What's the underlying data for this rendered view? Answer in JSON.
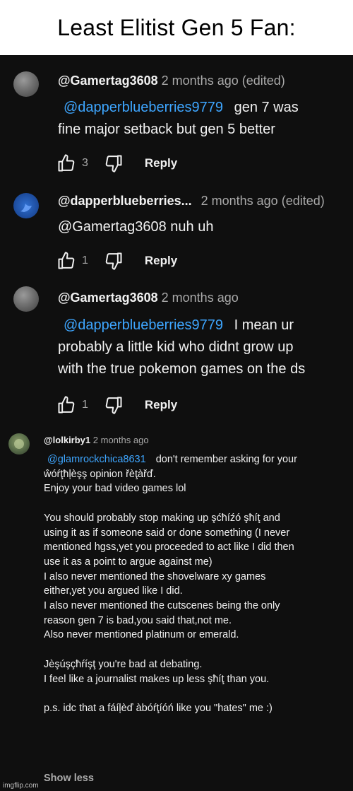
{
  "caption": "Least Elitist Gen 5 Fan:",
  "comments": [
    {
      "handle": "@Gamertag3608",
      "meta": "2 months ago (edited)",
      "mention": "@dapperblueberries9779",
      "lines": [
        "gen 7 was",
        "fine major setback but gen 5 better"
      ],
      "likes": "3",
      "reply": "Reply"
    },
    {
      "handle": "@dapperblueberries...",
      "meta": "2 months ago (edited)",
      "lines": [
        "@Gamertag3608 nuh uh"
      ],
      "likes": "1",
      "reply": "Reply"
    },
    {
      "handle": "@Gamertag3608",
      "meta": "2 months ago",
      "mention": "@dapperblueberries9779",
      "lines": [
        "I mean ur",
        "probably a little kid who didnt grow up",
        "with the true pokemon games on the ds"
      ],
      "likes": "1",
      "reply": "Reply"
    },
    {
      "handle": "@lolkirby1",
      "meta": "2 months ago",
      "mention": "@glamrockchica8631",
      "lines": [
        "don't remember asking for your",
        "ŵóŕţħļèşş opinion řèţàřď.",
        "Enjoy your bad video games lol",
        "",
        "You should probably stop making up şćħíźó şħíţ and",
        "using it as if someone said or done something (I never",
        "mentioned hgss,yet you proceeded to act like I did then",
        "use it as a point to argue against me)",
        "I also never mentioned the shovelware xy games",
        "either,yet you argued like I did.",
        "I also never mentioned the cutscenes being the only",
        "reason gen 7 is bad,you said that,not me.",
        "Also never mentioned platinum or emerald.",
        "",
        "Jèşúşçħŕíşţ you're bad at debating.",
        "I feel like a journalist makes up less şħíţ than you.",
        "",
        "p.s. idc that a fáíļèď àbóŕţíóń like you \"hates\" me :)"
      ],
      "show_less": "Show less"
    }
  ],
  "watermark": "imgflip.com"
}
